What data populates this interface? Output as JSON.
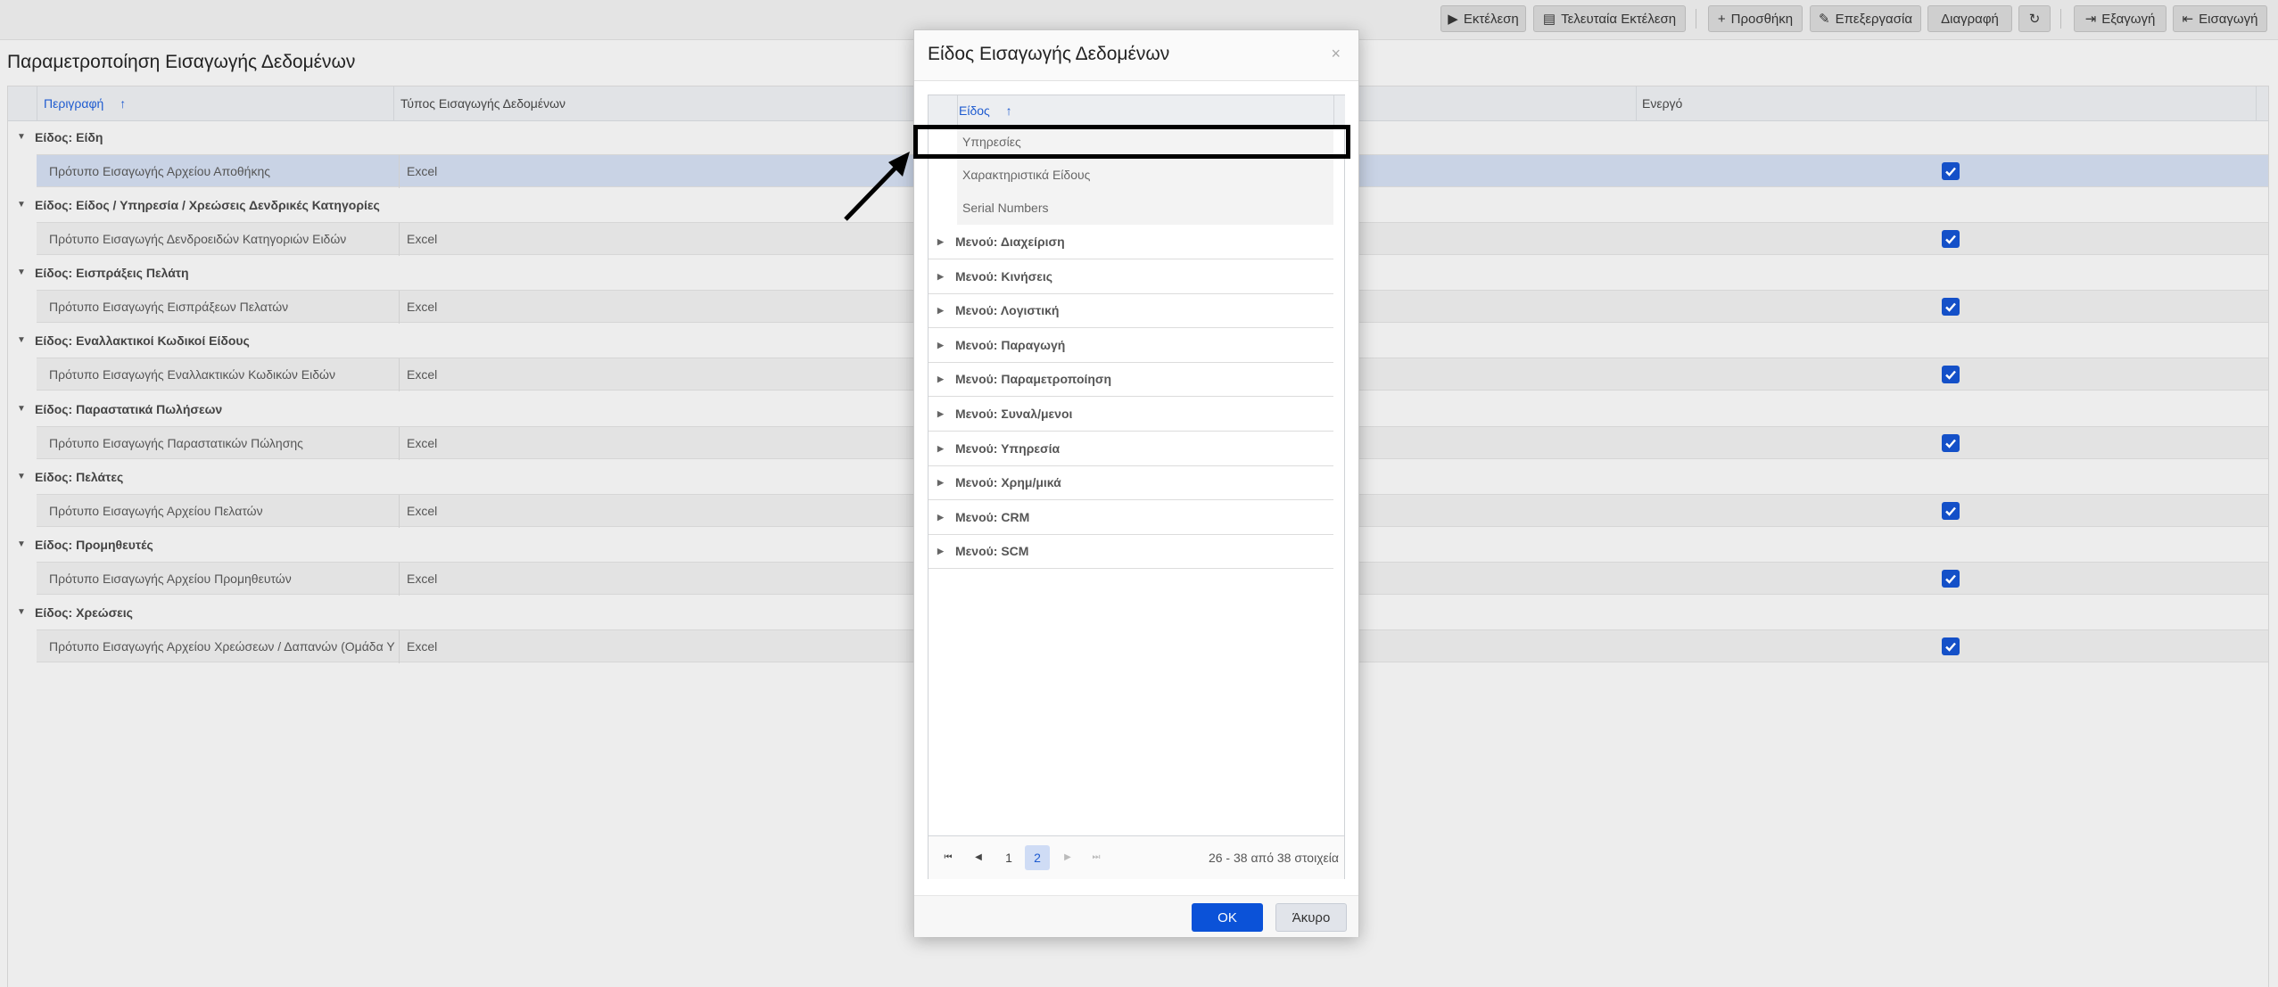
{
  "toolbar": {
    "buttons": [
      {
        "icon": "▶",
        "label": "Εκτέλεση"
      },
      {
        "icon": "▤",
        "label": "Τελευταία Εκτέλεση"
      },
      {
        "icon": "+",
        "label": "Προσθήκη"
      },
      {
        "icon": "✎",
        "label": "Επεξεργασία"
      },
      {
        "icon": "",
        "label": "Διαγραφή"
      },
      {
        "icon": "↻",
        "label": ""
      },
      {
        "icon": "⇥",
        "label": "Εξαγωγή"
      },
      {
        "icon": "⇤",
        "label": "Εισαγωγή"
      }
    ]
  },
  "page": {
    "title": "Παραμετροποίηση Εισαγωγής Δεδομένων"
  },
  "grid": {
    "columns": {
      "description": "Περιγραφή",
      "description_sort": "↑",
      "type": "Τύπος Εισαγωγής Δεδομένων",
      "active": "Ενεργό"
    },
    "groups": [
      {
        "label": "Είδος: Είδη",
        "row": {
          "description": "Πρότυπο Εισαγωγής Αρχείου Αποθήκης",
          "type": "Excel",
          "active": true,
          "selected": true
        }
      },
      {
        "label": "Είδος: Είδος / Υπηρεσία / Χρεώσεις Δενδρικές Κατηγορίες",
        "row": {
          "description": "Πρότυπο Εισαγωγής Δενδροειδών Κατηγοριών Ειδών",
          "type": "Excel",
          "active": true,
          "selected": false
        }
      },
      {
        "label": "Είδος: Εισπράξεις Πελάτη",
        "row": {
          "description": "Πρότυπο Εισαγωγής Εισπράξεων Πελατών",
          "type": "Excel",
          "active": true,
          "selected": false
        }
      },
      {
        "label": "Είδος: Εναλλακτικοί Κωδικοί Είδους",
        "row": {
          "description": "Πρότυπο Εισαγωγής Εναλλακτικών Κωδικών Ειδών",
          "type": "Excel",
          "active": true,
          "selected": false
        }
      },
      {
        "label": "Είδος: Παραστατικά Πωλήσεων",
        "row": {
          "description": "Πρότυπο Εισαγωγής Παραστατικών Πώλησης",
          "type": "Excel",
          "active": true,
          "selected": false
        }
      },
      {
        "label": "Είδος: Πελάτες",
        "row": {
          "description": "Πρότυπο Εισαγωγής Αρχείου Πελατών",
          "type": "Excel",
          "active": true,
          "selected": false
        }
      },
      {
        "label": "Είδος: Προμηθευτές",
        "row": {
          "description": "Πρότυπο Εισαγωγής Αρχείου Προμηθευτών",
          "type": "Excel",
          "active": true,
          "selected": false
        }
      },
      {
        "label": "Είδος: Χρεώσεις",
        "row": {
          "description": "Πρότυπο Εισαγωγής Αρχείου Χρεώσεων / Δαπανών (Ομάδα Υ",
          "type": "Excel",
          "active": true,
          "selected": false
        }
      }
    ]
  },
  "modal": {
    "title": "Είδος Εισαγωγής Δεδομένων",
    "close": "×",
    "column": "Είδος",
    "column_sort": "↑",
    "items": [
      "Υπηρεσίες",
      "Χαρακτηριστικά Είδους",
      "Serial Numbers"
    ],
    "groups": [
      "Μενού: Διαχείριση",
      "Μενού: Κινήσεις",
      "Μενού: Λογιστική",
      "Μενού: Παραγωγή",
      "Μενού: Παραμετροποίηση",
      "Μενού: Συναλ/μενοι",
      "Μενού: Υπηρεσία",
      "Μενού: Χρημ/μικά",
      "Μενού: CRM",
      "Μενού: SCM"
    ],
    "pager": {
      "first": "⏮",
      "prev": "◀",
      "pages": [
        "1",
        "2"
      ],
      "current_page": "2",
      "next": "▶",
      "last": "⏭",
      "info": "26 - 38 από 38 στοιχεία"
    },
    "ok_label": "OK",
    "cancel_label": "Άκυρο"
  },
  "colors": {
    "accent": "#0b52d8",
    "checkbox": "#1450c8",
    "selected_row": "#c9d3e5"
  }
}
